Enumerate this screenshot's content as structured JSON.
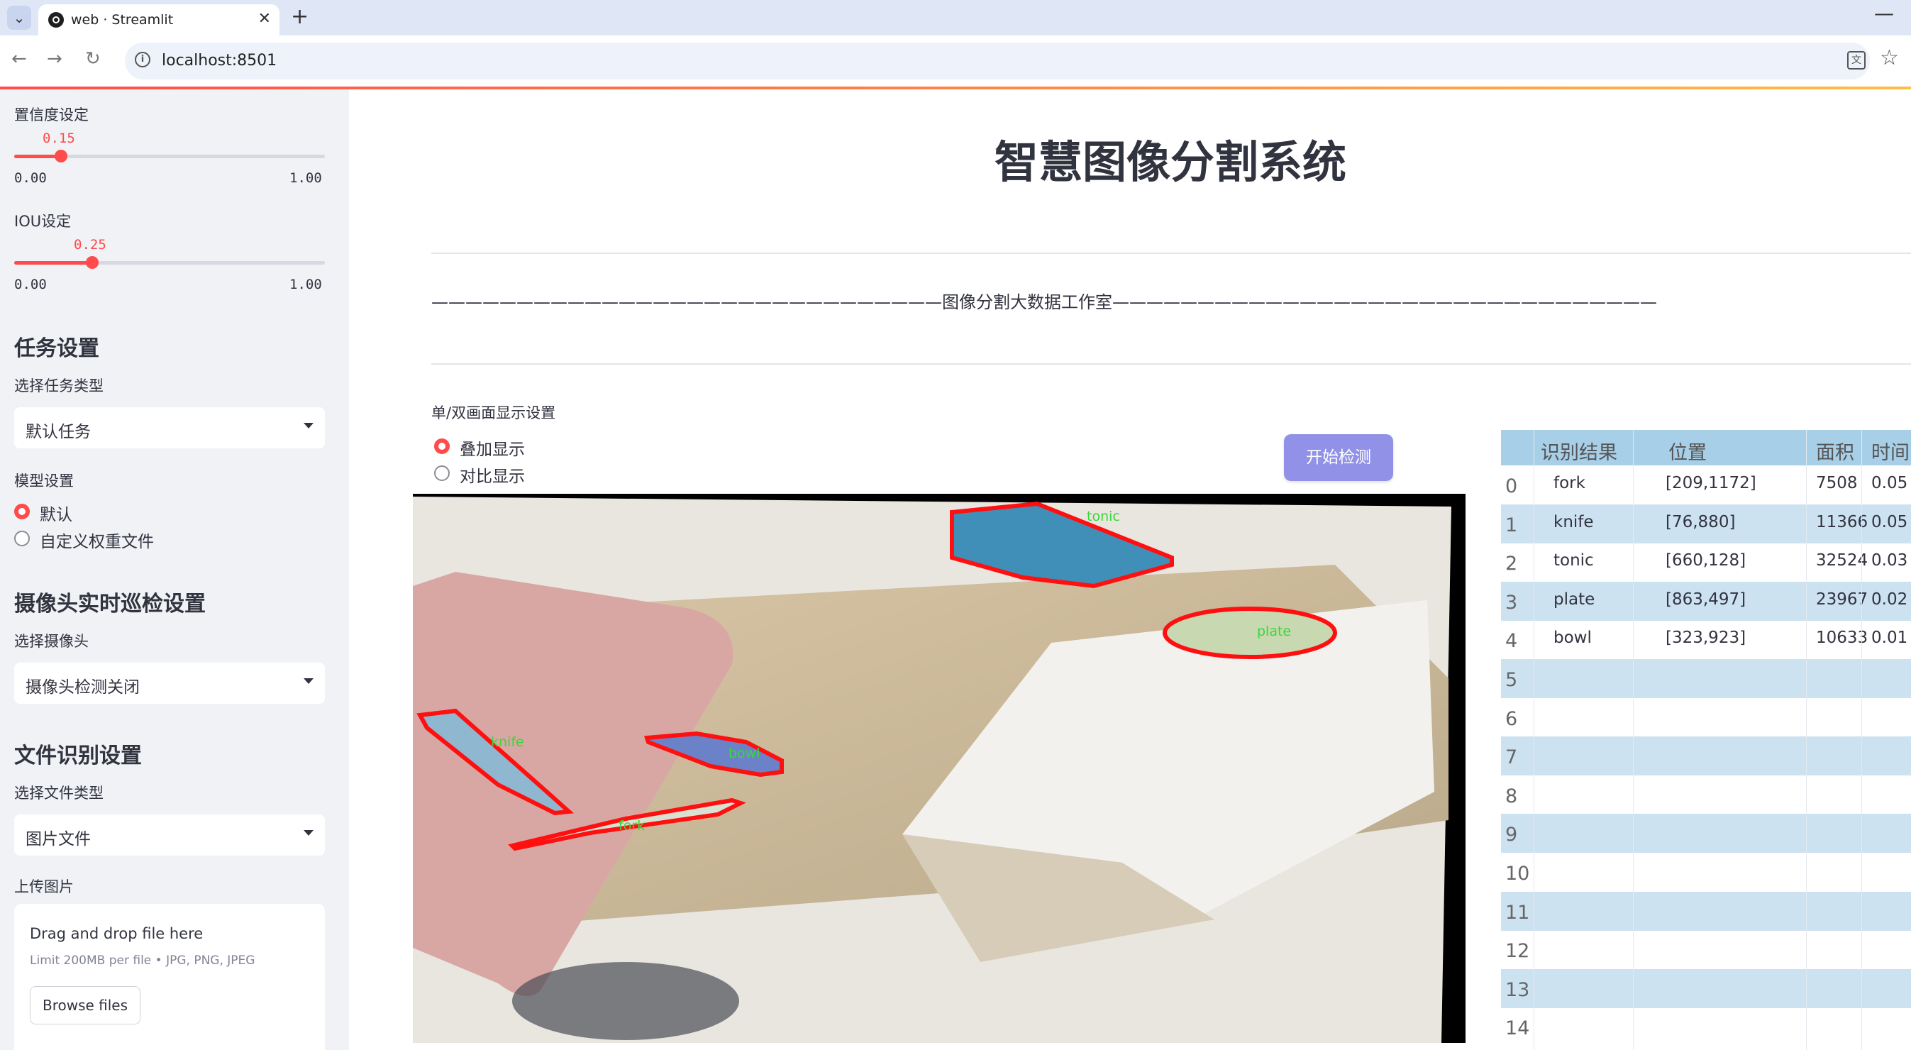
{
  "browser": {
    "tab_title": "web · Streamlit",
    "url": "localhost:8501"
  },
  "sidebar": {
    "confidence": {
      "label": "置信度设定",
      "value": "0.15",
      "value_fraction": 0.15,
      "min": "0.00",
      "max": "1.00"
    },
    "iou": {
      "label": "IOU设定",
      "value": "0.25",
      "value_fraction": 0.25,
      "min": "0.00",
      "max": "1.00"
    },
    "task_header": "任务设置",
    "task_type_label": "选择任务类型",
    "task_type_value": "默认任务",
    "model_label": "模型设置",
    "model_options": [
      "默认",
      "自定义权重文件"
    ],
    "model_selected": 0,
    "camera_header": "摄像头实时巡检设置",
    "camera_label": "选择摄像头",
    "camera_value": "摄像头检测关闭",
    "file_header": "文件识别设置",
    "file_type_label": "选择文件类型",
    "file_type_value": "图片文件",
    "upload_label": "上传图片",
    "upload": {
      "drop_text": "Drag and drop file here",
      "limit_text": "Limit 200MB per file • JPG, PNG, JPEG",
      "browse_label": "Browse files"
    }
  },
  "main": {
    "title": "智慧图像分割系统",
    "subtitle": "——————————————————————————————图像分割大数据工作室————————————————————————————————",
    "display_label": "单/双画面显示设置",
    "display_options": [
      "叠加显示",
      "对比显示"
    ],
    "display_selected": 0,
    "start_button": "开始检测"
  },
  "detections": [
    {
      "label": "fork"
    },
    {
      "label": "knife"
    },
    {
      "label": "tonic"
    },
    {
      "label": "plate"
    },
    {
      "label": "bowl"
    }
  ],
  "table": {
    "columns": [
      "识别结果",
      "位置",
      "面积",
      "时间"
    ],
    "rows": [
      {
        "index": "0",
        "result": "fork",
        "position": "[209,1172]",
        "area": "7508",
        "time": "0.05"
      },
      {
        "index": "1",
        "result": "knife",
        "position": "[76,880]",
        "area": "11366",
        "time": "0.05"
      },
      {
        "index": "2",
        "result": "tonic",
        "position": "[660,128]",
        "area": "32524",
        "time": "0.03"
      },
      {
        "index": "3",
        "result": "plate",
        "position": "[863,497]",
        "area": "23967",
        "time": "0.02"
      },
      {
        "index": "4",
        "result": "bowl",
        "position": "[323,923]",
        "area": "10633",
        "time": "0.01"
      },
      {
        "index": "5"
      },
      {
        "index": "6"
      },
      {
        "index": "7"
      },
      {
        "index": "8"
      },
      {
        "index": "9"
      },
      {
        "index": "10"
      },
      {
        "index": "11"
      },
      {
        "index": "12"
      },
      {
        "index": "13"
      },
      {
        "index": "14"
      }
    ]
  },
  "colors": {
    "accent": "#ff4b4b",
    "button": "#9191e8",
    "table_header": "#a8cfe8",
    "table_shade": "#cde2f1"
  }
}
